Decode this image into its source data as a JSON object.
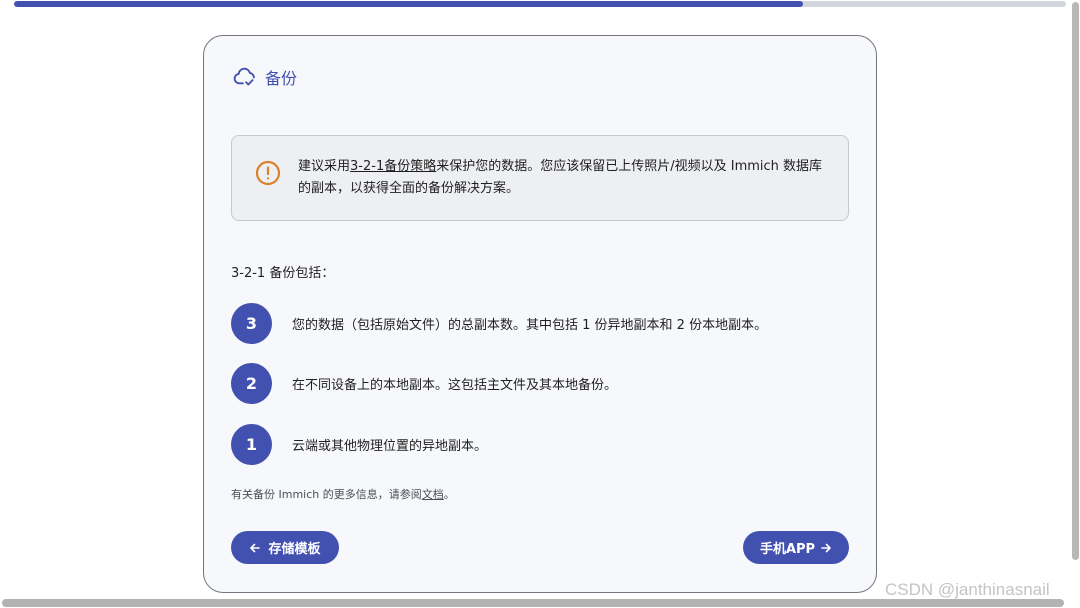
{
  "progress": {
    "fraction": 0.75
  },
  "card": {
    "title": "备份",
    "icon": "cloud-check-icon"
  },
  "alert": {
    "icon": "alert-circle-icon",
    "prefix": "建议采用",
    "link": "3-2-1备份策略",
    "suffix": "来保护您的数据。您应该保留已上传照片/视频以及 Immich 数据库的副本，以获得全面的备份解决方案。"
  },
  "includes_label": "3-2-1 备份包括：",
  "rules": [
    {
      "number": "3",
      "text": "您的数据（包括原始文件）的总副本数。其中包括 1 份异地副本和 2 份本地副本。"
    },
    {
      "number": "2",
      "text": "在不同设备上的本地副本。这包括主文件及其本地备份。"
    },
    {
      "number": "1",
      "text": "云端或其他物理位置的异地副本。"
    }
  ],
  "footnote": {
    "prefix": "有关备份 Immich 的更多信息，请参阅",
    "link": "文档",
    "suffix": "。"
  },
  "buttons": {
    "back_label": "存储模板",
    "back_icon": "arrow-left-icon",
    "next_label": "手机APP",
    "next_icon": "arrow-right-icon"
  },
  "watermark": "CSDN @janthinasnail",
  "colors": {
    "accent": "#4250af",
    "warning": "#d9822b",
    "card_background": "#f7f8fb",
    "alert_background": "#eeeff2"
  }
}
